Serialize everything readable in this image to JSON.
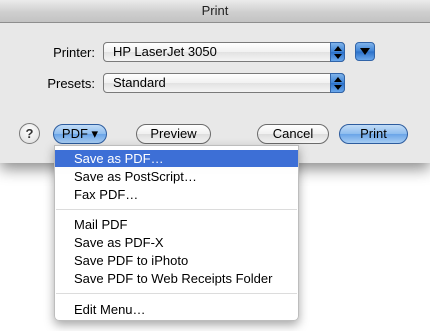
{
  "window": {
    "title": "Print"
  },
  "printer": {
    "label": "Printer:",
    "value": "HP LaserJet 3050"
  },
  "presets": {
    "label": "Presets:",
    "value": "Standard"
  },
  "buttons": {
    "help": "?",
    "pdf": "PDF ▾",
    "preview": "Preview",
    "cancel": "Cancel",
    "print": "Print"
  },
  "pdf_menu": {
    "items": [
      "Save as PDF…",
      "Save as PostScript…",
      "Fax PDF…",
      "Mail PDF",
      "Save as PDF-X",
      "Save PDF to iPhoto",
      "Save PDF to Web Receipts Folder",
      "Edit Menu…"
    ],
    "selected_index": 0
  },
  "colors": {
    "accent": "#3d6fd6",
    "window_bg": "#e8e8e8",
    "blue_control": "#3d83d6"
  },
  "icons": {
    "popup": "up-down-arrows-icon",
    "disclosure": "disclosure-triangle-icon"
  }
}
